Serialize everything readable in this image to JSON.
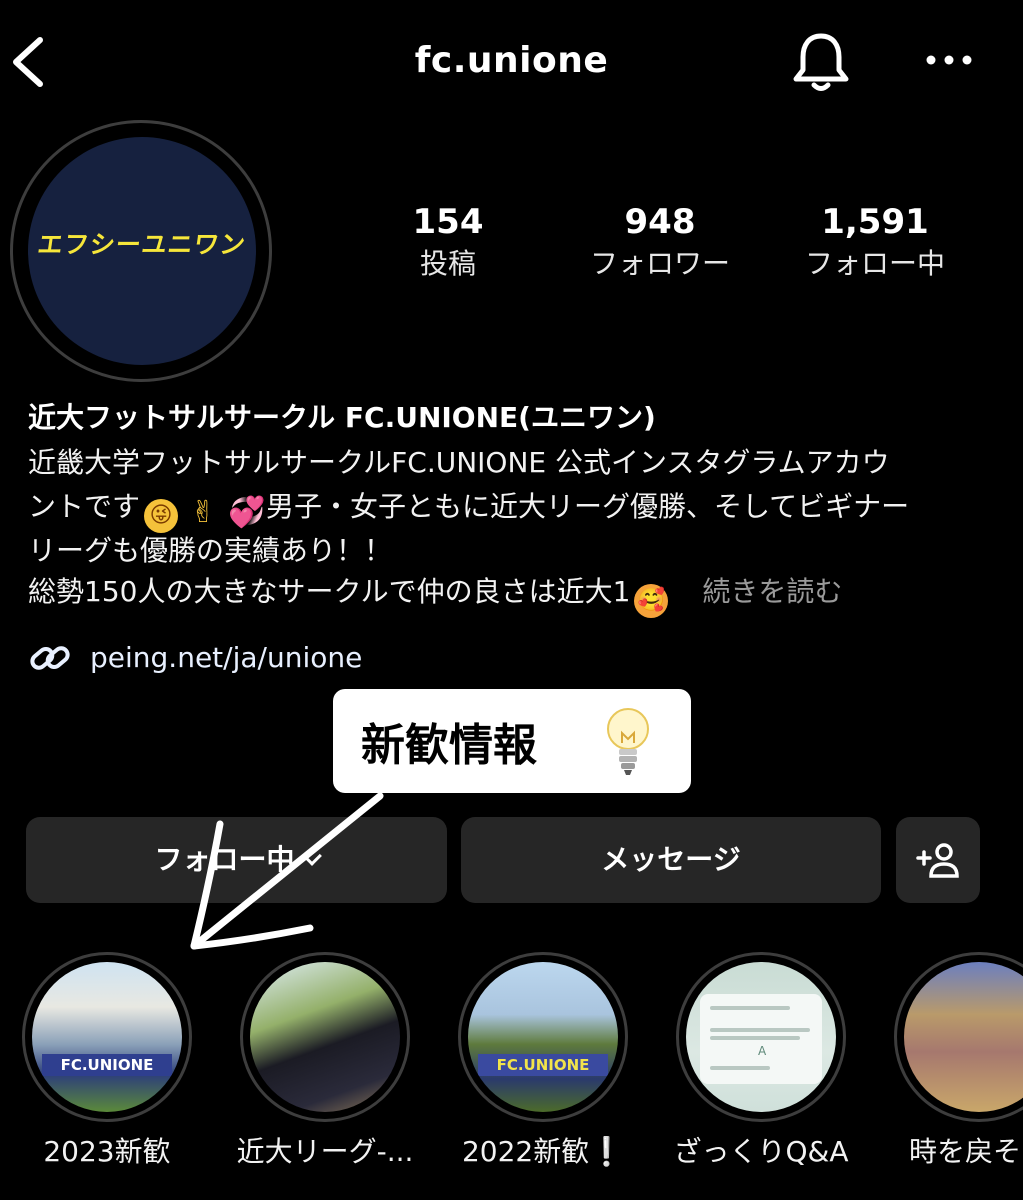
{
  "header": {
    "username": "fc.unione",
    "back_icon": "chevron-left-icon",
    "bell_icon": "bell-icon",
    "more_icon": "more-horizontal-icon"
  },
  "profile": {
    "avatar_text": "エフシーユニワン",
    "stats": {
      "posts": {
        "value": "154",
        "label": "投稿"
      },
      "followers": {
        "value": "948",
        "label": "フォロワー"
      },
      "following": {
        "value": "1,591",
        "label": "フォロー中"
      }
    },
    "name": "近大フットサルサークル FC.UNIONE(ユニワン)",
    "bio": {
      "line1": "近畿大学フットサルサークルFC.UNIONE 公式インスタグラムアカウ",
      "line2_a": "ントです",
      "line2_b": "男子・女子ともに近大リーグ優勝、そしてビギナー",
      "line3": "リーグも優勝の実績あり！！",
      "line4": "総勢150人の大きなサークルで仲の良さは近大1",
      "read_more": "続きを読む"
    },
    "link": "peing.net/ja/unione"
  },
  "annotation": {
    "callout": "新歓情報"
  },
  "buttons": {
    "following": "フォロー中",
    "message": "メッセージ",
    "add_user_icon": "add-user-icon"
  },
  "highlights": [
    {
      "label": "2023新歓",
      "image_text": "FC.UNIONE"
    },
    {
      "label": "近大リーグ-..."
    },
    {
      "label": "2022新歓❕",
      "image_text": "FC.UNIONE"
    },
    {
      "label": "ざっくりQ&A",
      "image_text": "A"
    },
    {
      "label": "時を戻そう"
    }
  ],
  "colors": {
    "background": "#000000",
    "button": "#262626",
    "link": "#e8f0ff",
    "muted": "#9a9a9a",
    "avatar_bg": "#16213f",
    "avatar_text": "#f6e63a"
  }
}
